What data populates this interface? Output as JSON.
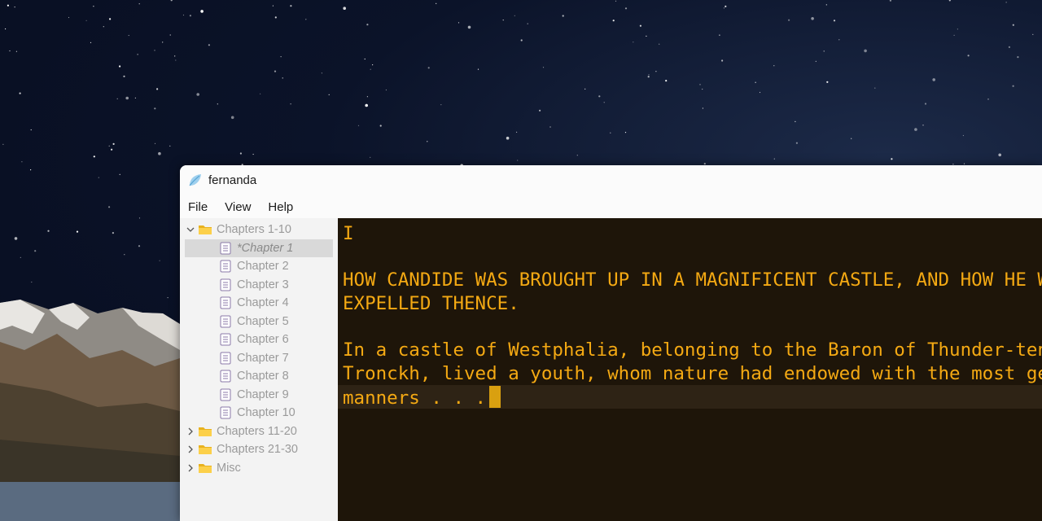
{
  "window": {
    "title": "fernanda",
    "icon": "feather-leaf-icon"
  },
  "menu": {
    "items": [
      "File",
      "View",
      "Help"
    ]
  },
  "sidebar": {
    "tree": [
      {
        "type": "folder",
        "label": "Chapters 1-10",
        "expanded": true
      },
      {
        "type": "file",
        "label": "*Chapter 1",
        "selected": true
      },
      {
        "type": "file",
        "label": "Chapter 2"
      },
      {
        "type": "file",
        "label": "Chapter 3"
      },
      {
        "type": "file",
        "label": "Chapter 4"
      },
      {
        "type": "file",
        "label": "Chapter 5"
      },
      {
        "type": "file",
        "label": "Chapter 6"
      },
      {
        "type": "file",
        "label": "Chapter 7"
      },
      {
        "type": "file",
        "label": "Chapter 8"
      },
      {
        "type": "file",
        "label": "Chapter 9"
      },
      {
        "type": "file",
        "label": "Chapter 10"
      },
      {
        "type": "folder",
        "label": "Chapters 11-20",
        "expanded": false
      },
      {
        "type": "folder",
        "label": "Chapters 21-30",
        "expanded": false
      },
      {
        "type": "folder",
        "label": "Misc",
        "expanded": false
      }
    ]
  },
  "editor": {
    "lines": [
      "I",
      "",
      "HOW CANDIDE WAS BROUGHT UP IN A MAGNIFICENT CASTLE, AND HOW HE WAS",
      "EXPELLED THENCE.",
      "",
      "In a castle of Westphalia, belonging to the Baron of Thunder-ten-",
      "Tronckh, lived a youth, whom nature had endowed with the most gentle",
      "manners . . ."
    ],
    "text_color": "#f4a913",
    "background": "#1e1509"
  }
}
